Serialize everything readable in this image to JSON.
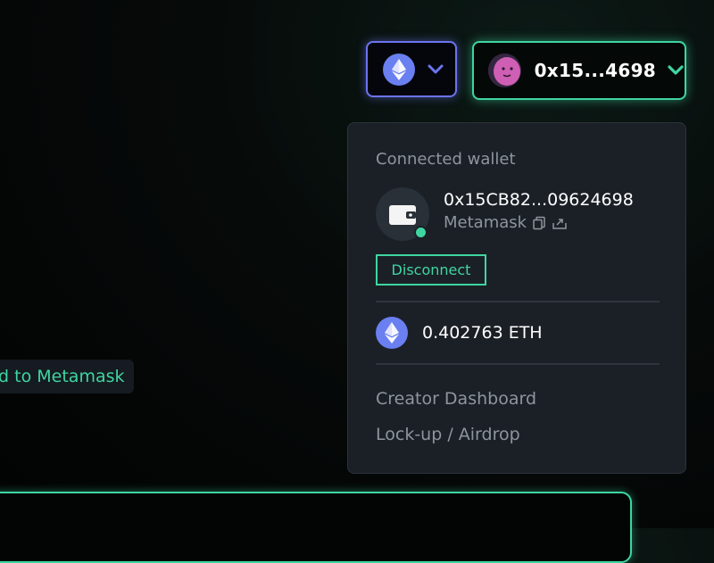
{
  "network_button": {
    "icon": "ethereum-icon",
    "chevron": "chevron-down-icon"
  },
  "account_button": {
    "address": "0x15...4698",
    "avatar": "avatar",
    "chevron": "chevron-down-icon"
  },
  "dropdown": {
    "connected_label": "Connected wallet",
    "wallet_address": "0x15CB82...09624698",
    "wallet_provider": "Metamask",
    "copy_icon": "copy-icon",
    "link_icon": "external-link-icon",
    "disconnect_label": "Disconnect",
    "balance": "0.402763 ETH",
    "menu": [
      {
        "label": "Creator Dashboard"
      },
      {
        "label": "Lock-up / Airdrop"
      }
    ]
  },
  "left_pill": {
    "label": "dd to Metamask"
  },
  "colors": {
    "accent": "#3fd5a1",
    "network": "#6b74f0",
    "panel": "#1b2027",
    "muted": "#8e959c"
  }
}
